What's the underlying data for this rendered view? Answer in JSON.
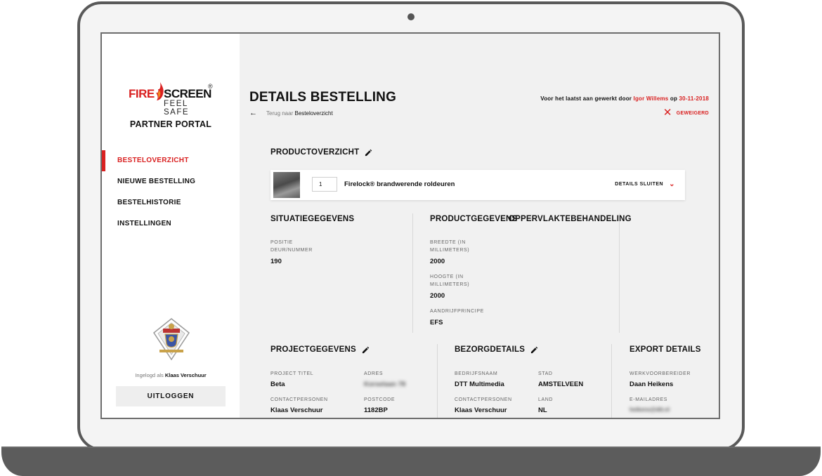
{
  "sidebar": {
    "logo": {
      "fire": "FIRE",
      "screen": "SCREEN",
      "tagline": "FEEL SAFE",
      "reg": "®"
    },
    "portal_title": "PARTNER PORTAL",
    "nav": [
      {
        "label": "BESTELOVERZICHT",
        "active": true
      },
      {
        "label": "NIEUWE BESTELLING",
        "active": false
      },
      {
        "label": "BESTELHISTORIE",
        "active": false
      },
      {
        "label": "INSTELLINGEN",
        "active": false
      }
    ],
    "logged_in_prefix": "Ingelogd als",
    "logged_in_user": "Klaas Verschuur",
    "logout_label": "UITLOGGEN"
  },
  "header": {
    "title": "DETAILS BESTELLING",
    "back_prefix": "Terug naar",
    "back_link": "Besteloverzicht",
    "last_edit_prefix": "Voor het laatst aan gewerkt door",
    "last_edit_user": "Igor Willems",
    "last_edit_mid": "op",
    "last_edit_date": "30-11-2018",
    "status": "GEWEIGERD"
  },
  "product_overview": {
    "title": "PRODUCTOVERZICHT",
    "quantity": "1",
    "product_name": "Firelock® brandwerende roldeuren",
    "details_toggle": "DETAILS SLUITEN"
  },
  "situation": {
    "title": "SITUATIEGEGEVENS",
    "fields": [
      {
        "label": "POSITIE DEUR/NUMMER",
        "value": "190"
      }
    ]
  },
  "product_data": {
    "title": "PRODUCTGEGEVENS",
    "fields": [
      {
        "label": "BREEDTE (IN MILLIMETERS)",
        "value": "2000"
      },
      {
        "label": "HOOGTE (IN MILLIMETERS)",
        "value": "2000"
      },
      {
        "label": "AANDRIJFPRINCIPE",
        "value": "EFS"
      }
    ]
  },
  "surface": {
    "title": "OPPERVLAKTEBEHANDELING"
  },
  "project": {
    "title": "PROJECTGEGEVENS",
    "fields": [
      {
        "label": "PROJECT TITEL",
        "value": "Beta"
      },
      {
        "label": "ADRES",
        "value": "Korselaan 78"
      },
      {
        "label": "CONTACTPERSONEN",
        "value": "Klaas Verschuur"
      },
      {
        "label": "POSTCODE",
        "value": "1182BP"
      }
    ]
  },
  "delivery": {
    "title": "BEZORGDETAILS",
    "fields": [
      {
        "label": "BEDRIJFSNAAM",
        "value": "DTT Multimedia"
      },
      {
        "label": "STAD",
        "value": "AMSTELVEEN"
      },
      {
        "label": "CONTACTPERSONEN",
        "value": "Klaas Verschuur"
      },
      {
        "label": "LAND",
        "value": "NL"
      }
    ]
  },
  "export": {
    "title": "EXPORT DETAILS",
    "fields": [
      {
        "label": "WERKVOORBEREIDER",
        "value": "Daan Heikens"
      },
      {
        "label": "E-MAILADRES",
        "value": "heikens@dtt.nl"
      }
    ]
  },
  "colors": {
    "accent": "#d92121",
    "background": "#f1f1f1",
    "sidebar": "#ffffff",
    "bezel": "#595959"
  },
  "icons": [
    "flame-icon",
    "back-arrow-icon",
    "close-icon",
    "pencil-icon",
    "chevron-down-icon",
    "crest-icon"
  ]
}
